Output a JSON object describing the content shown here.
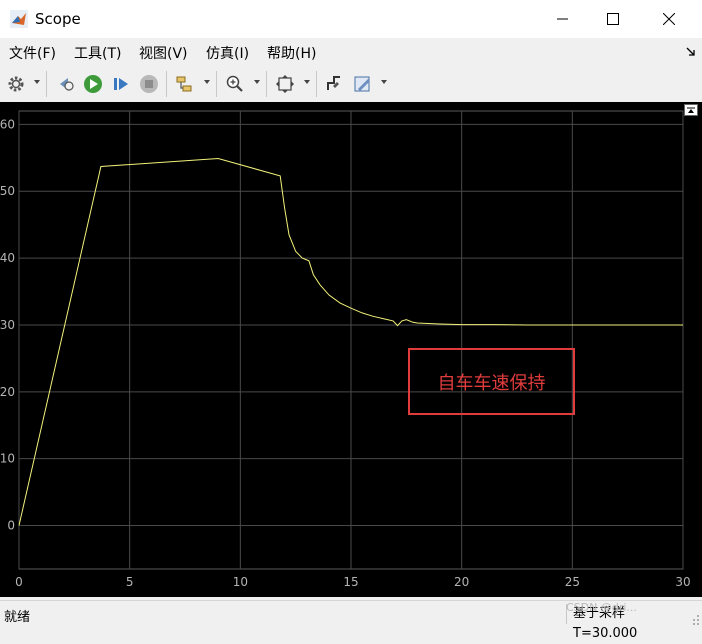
{
  "window": {
    "title": "Scope"
  },
  "menu": {
    "items": [
      "文件(F)",
      "工具(T)",
      "视图(V)",
      "仿真(I)",
      "帮助(H)"
    ]
  },
  "toolbar": {
    "icons": [
      "gear-icon",
      "step-back-icon",
      "run-icon",
      "step-forward-icon",
      "stop-icon",
      "signal-select-icon",
      "zoom-icon",
      "autoscale-icon",
      "highlight-icon",
      "style-icon"
    ]
  },
  "annotation": {
    "text": "自车车速保持",
    "border_color": "#e03c3c",
    "text_color": "#e03c3c"
  },
  "status": {
    "left": "就绪",
    "right": "基于采样  T=30.000"
  },
  "watermark": "CSDN @dri...",
  "colors": {
    "plot_bg": "#000000",
    "trace": "#f2f27a",
    "grid": "#4a4a4a",
    "axis_text": "#b4b4b4"
  },
  "chart_data": {
    "type": "line",
    "title": "",
    "xlabel": "",
    "ylabel": "",
    "xlim": [
      0,
      30
    ],
    "ylim": [
      -6.5,
      62
    ],
    "xticks": [
      0,
      5,
      10,
      15,
      20,
      25,
      30
    ],
    "yticks": [
      0,
      10,
      20,
      30,
      40,
      50,
      60
    ],
    "grid": true,
    "series": [
      {
        "values_x": [
          0,
          3.7,
          9.0,
          11.8,
          12.0,
          12.2,
          12.5,
          12.8,
          13.1,
          13.3,
          13.6,
          14.0,
          14.5,
          15.0,
          15.5,
          16.0,
          16.5,
          16.9,
          17.1,
          17.3,
          17.5,
          17.8,
          18.0,
          19.0,
          20.0,
          21.5,
          23.0,
          25.0,
          30.0
        ],
        "values_y": [
          0,
          53.7,
          54.9,
          52.3,
          47.5,
          43.5,
          41.0,
          40.0,
          39.6,
          37.5,
          36.0,
          34.5,
          33.3,
          32.5,
          31.8,
          31.3,
          30.9,
          30.6,
          29.9,
          30.6,
          30.8,
          30.4,
          30.3,
          30.15,
          30.05,
          30.05,
          30.0,
          30.0,
          30.0
        ]
      }
    ]
  }
}
